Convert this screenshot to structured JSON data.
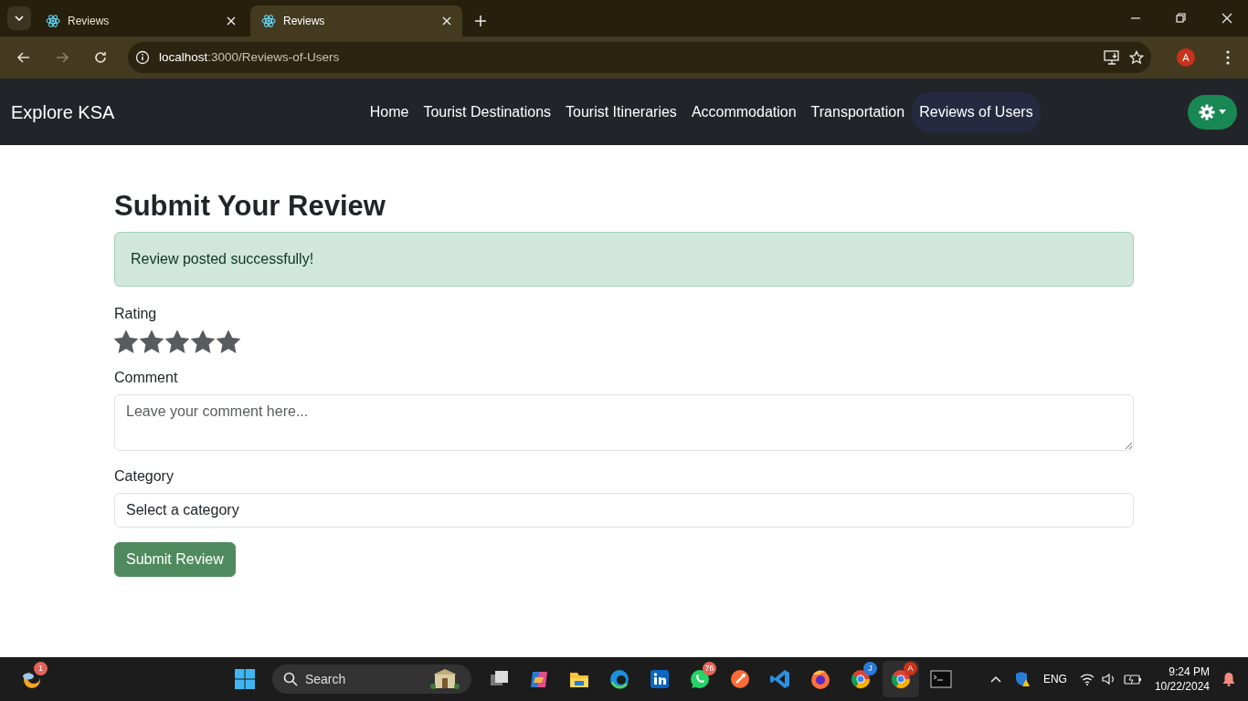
{
  "browser": {
    "tabs": [
      {
        "title": "Reviews",
        "selected": false
      },
      {
        "title": "Reviews",
        "selected": true
      }
    ],
    "address_host": "localhost",
    "address_path": ":3000/Reviews-of-Users",
    "profile_initial": "A"
  },
  "navbar": {
    "brand": "Explore KSA",
    "links": [
      {
        "label": "Home",
        "selected": false
      },
      {
        "label": "Tourist Destinations",
        "selected": false
      },
      {
        "label": "Tourist Itineraries",
        "selected": false
      },
      {
        "label": "Accommodation",
        "selected": false
      },
      {
        "label": "Transportation",
        "selected": false
      },
      {
        "label": "Reviews of Users",
        "selected": true
      }
    ]
  },
  "form": {
    "title": "Submit Your Review",
    "alert": "Review posted successfully!",
    "rating_label": "Rating",
    "stars": 5,
    "comment_label": "Comment",
    "comment_placeholder": "Leave your comment here...",
    "category_label": "Category",
    "category_value": "Select a category",
    "submit": "Submit Review"
  },
  "taskbar": {
    "widgets_badge": "1",
    "search_placeholder": "Search",
    "apps": [
      {
        "kind": "taskview",
        "selected": false
      },
      {
        "kind": "copilot",
        "selected": false
      },
      {
        "kind": "files",
        "selected": false
      },
      {
        "kind": "edge",
        "selected": false
      },
      {
        "kind": "linkedin",
        "selected": false
      },
      {
        "kind": "whatsapp",
        "badge": "76",
        "selected": false
      },
      {
        "kind": "postman",
        "selected": false
      },
      {
        "kind": "vscode",
        "selected": false
      },
      {
        "kind": "firefox",
        "selected": false
      },
      {
        "kind": "chrome",
        "badge": "J",
        "selected": false
      },
      {
        "kind": "chrome",
        "badge": "A",
        "selected": true
      },
      {
        "kind": "terminal",
        "selected": false
      }
    ],
    "language": "ENG",
    "time": "9:24 PM",
    "date": "10/22/2024"
  }
}
